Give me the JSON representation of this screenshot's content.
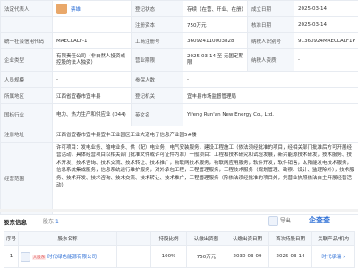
{
  "grid": {
    "r1": {
      "legal_label": "法定代表人",
      "legal_name": "蔡雄",
      "status_label": "登记状态",
      "status_value": "存续（在营、开业、在册）",
      "est_label": "成立日期",
      "est_value": "2025-03-14"
    },
    "r2": {
      "capital_label": "注册资本",
      "capital_value": "750万元",
      "approved_label": "核准日期",
      "approved_value": "2025-03-14"
    },
    "r3": {
      "uscc_label": "统一社会信用代码",
      "uscc_value": "MAECLALF-1",
      "biz_label": "工商注册号",
      "biz_value": "360924110003828",
      "tax_label": "纳税人识别号",
      "tax_value": "91360924MAECLALF1P"
    },
    "r4": {
      "type_label": "企业类型",
      "type_value": "有限责任公司（非自然人投资或控股的法人独资）",
      "term_label": "营业期限",
      "term_value": "2025-03-14 至 无固定期限",
      "tq_label": "纳税人资质",
      "tq_value": "-"
    },
    "r5": {
      "staff_label": "人员规模",
      "staff_value": "-",
      "insured_label": "参保人数",
      "insured_value": "-"
    },
    "r6": {
      "region_label": "所属地区",
      "region_value": "江西省宜春市宜丰县",
      "auth_label": "登记机关",
      "auth_value": "宜丰县市场监督管理局"
    },
    "r7": {
      "industry_label": "国标行业",
      "industry_value": "电力、热力生产和供应业 (D44)",
      "en_label": "英文名",
      "en_value": "Yifeng Run'an New Energy Co., Ltd."
    },
    "r8": {
      "addr_label": "注册地址",
      "addr_value": "江西省宜春市宜丰县宜丰工业园区工业大道电子信息产业园5#楼"
    },
    "r9": {
      "scope_label": "经营范围",
      "scope_value": "许可项目：发电业务、输电业务、供（配）电业务，电气安装服务，建设工程施工（依法须经批准的项目，经相关部门批准后方可开展经营活动，具体经营项目以相关部门批准文件或许可证件为准）一般项目：工程和技术研究和试验发展，新兴能源技术研发，技术服务、技术开发、技术咨询、技术交流、技术转让、技术推广，物联网技术服务，物联网应用服务，软件开发，软件销售，太阳能发电技术服务，信息系统集成服务，信息系统运行维护服务，对外承包工程，工程管理服务，工程技术服务（规划管理、勘察、设计、监理除外），技术服务、技术开发、技术咨询、技术交流、技术转让、技术推广，工程管理服务（除依法须经批准的项目外，凭营业执照依法自主开展经营活动）"
    }
  },
  "section": {
    "title": "股东信息",
    "badge_label": "股东",
    "count": "1",
    "export_label": "导出",
    "brand": "企查查"
  },
  "investors": {
    "headers": [
      "序号",
      "股东名称",
      "",
      "持股比例",
      "认缴出资额",
      "认缴出资日期",
      "首次持股日期",
      "关联产品/机构"
    ],
    "row": {
      "index": "1",
      "tag": "大股东",
      "name": "时代绿色能源有限公司",
      "ratio": "100%",
      "amount": "750万元",
      "sub_date": "2030-03-09",
      "first_date": "2025-03-14",
      "product": "时代承瑞"
    }
  }
}
